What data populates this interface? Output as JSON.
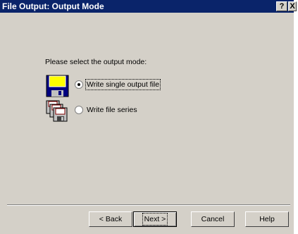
{
  "window": {
    "title": "File Output: Output Mode",
    "help_glyph": "?",
    "close_glyph": "X"
  },
  "content": {
    "prompt": "Please select the output mode:",
    "options": [
      {
        "label": "Write single output file",
        "selected": true,
        "icon": "floppy-disk-icon"
      },
      {
        "label": "Write file series",
        "selected": false,
        "icon": "floppy-stack-icon"
      }
    ]
  },
  "buttons": {
    "back": "< Back",
    "next": "Next >",
    "cancel": "Cancel",
    "help": "Help"
  },
  "colors": {
    "titlebar": "#0a246a",
    "dialog_bg": "#d4d0c8"
  }
}
